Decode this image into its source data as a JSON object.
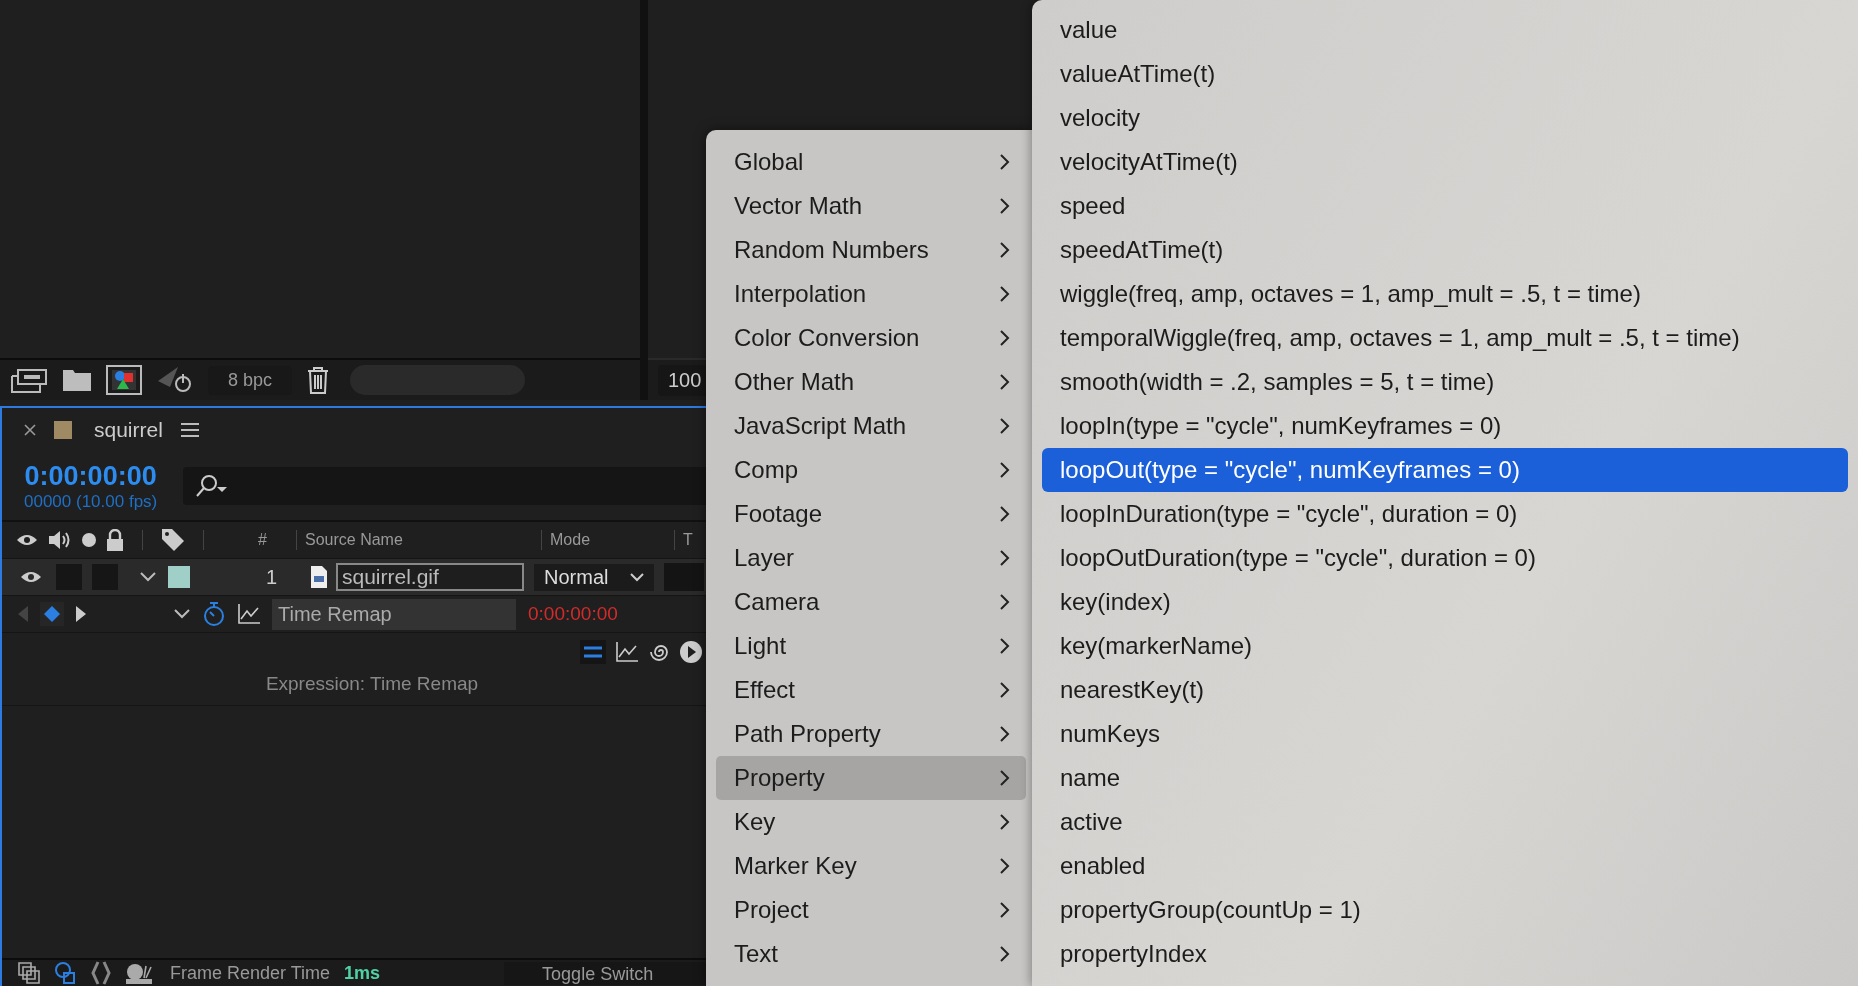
{
  "project_panel": {
    "depth": "8 bpc"
  },
  "viewer": {
    "zoom": "100"
  },
  "timeline": {
    "title": "squirrel",
    "timecode": "0:00:00:00",
    "frame_info": "00000 (10.00 fps)",
    "columns": [
      "#",
      "Source Name",
      "Mode",
      "T"
    ],
    "layers": [
      {
        "number": "1",
        "name": "squirrel.gif",
        "mode": "Normal",
        "visible": true,
        "expanded": true,
        "properties": [
          {
            "name": "Time Remap",
            "value": "0:00:00:00",
            "stopwatch": true,
            "expression": "Expression: Time Remap"
          }
        ]
      }
    ]
  },
  "status_bar": {
    "label": "Frame Render Time",
    "value": "1ms",
    "toggle": "Toggle Switch"
  },
  "menu": {
    "items": [
      {
        "label": "Global",
        "selected": false
      },
      {
        "label": "Vector Math",
        "selected": false
      },
      {
        "label": "Random Numbers",
        "selected": false
      },
      {
        "label": "Interpolation",
        "selected": false
      },
      {
        "label": "Color Conversion",
        "selected": false
      },
      {
        "label": "Other Math",
        "selected": false
      },
      {
        "label": "JavaScript Math",
        "selected": false
      },
      {
        "label": "Comp",
        "selected": false
      },
      {
        "label": "Footage",
        "selected": false
      },
      {
        "label": "Layer",
        "selected": false
      },
      {
        "label": "Camera",
        "selected": false
      },
      {
        "label": "Light",
        "selected": false
      },
      {
        "label": "Effect",
        "selected": false
      },
      {
        "label": "Path Property",
        "selected": false
      },
      {
        "label": "Property",
        "selected": true
      },
      {
        "label": "Key",
        "selected": false
      },
      {
        "label": "Marker Key",
        "selected": false
      },
      {
        "label": "Project",
        "selected": false
      },
      {
        "label": "Text",
        "selected": false
      }
    ],
    "submenu": {
      "items": [
        {
          "label": "value",
          "selected": false
        },
        {
          "label": "valueAtTime(t)",
          "selected": false
        },
        {
          "label": "velocity",
          "selected": false
        },
        {
          "label": "velocityAtTime(t)",
          "selected": false
        },
        {
          "label": "speed",
          "selected": false
        },
        {
          "label": "speedAtTime(t)",
          "selected": false
        },
        {
          "label": "wiggle(freq, amp, octaves = 1, amp_mult = .5, t = time)",
          "selected": false
        },
        {
          "label": "temporalWiggle(freq, amp, octaves = 1, amp_mult = .5, t = time)",
          "selected": false
        },
        {
          "label": "smooth(width = .2, samples = 5, t = time)",
          "selected": false
        },
        {
          "label": "loopIn(type = \"cycle\", numKeyframes = 0)",
          "selected": false
        },
        {
          "label": "loopOut(type = \"cycle\", numKeyframes = 0)",
          "selected": true
        },
        {
          "label": "loopInDuration(type = \"cycle\", duration = 0)",
          "selected": false
        },
        {
          "label": "loopOutDuration(type = \"cycle\", duration = 0)",
          "selected": false
        },
        {
          "label": "key(index)",
          "selected": false
        },
        {
          "label": "key(markerName)",
          "selected": false
        },
        {
          "label": "nearestKey(t)",
          "selected": false
        },
        {
          "label": "numKeys",
          "selected": false
        },
        {
          "label": "name",
          "selected": false
        },
        {
          "label": "active",
          "selected": false
        },
        {
          "label": "enabled",
          "selected": false
        },
        {
          "label": "propertyGroup(countUp = 1)",
          "selected": false
        },
        {
          "label": "propertyIndex",
          "selected": false
        }
      ]
    }
  }
}
